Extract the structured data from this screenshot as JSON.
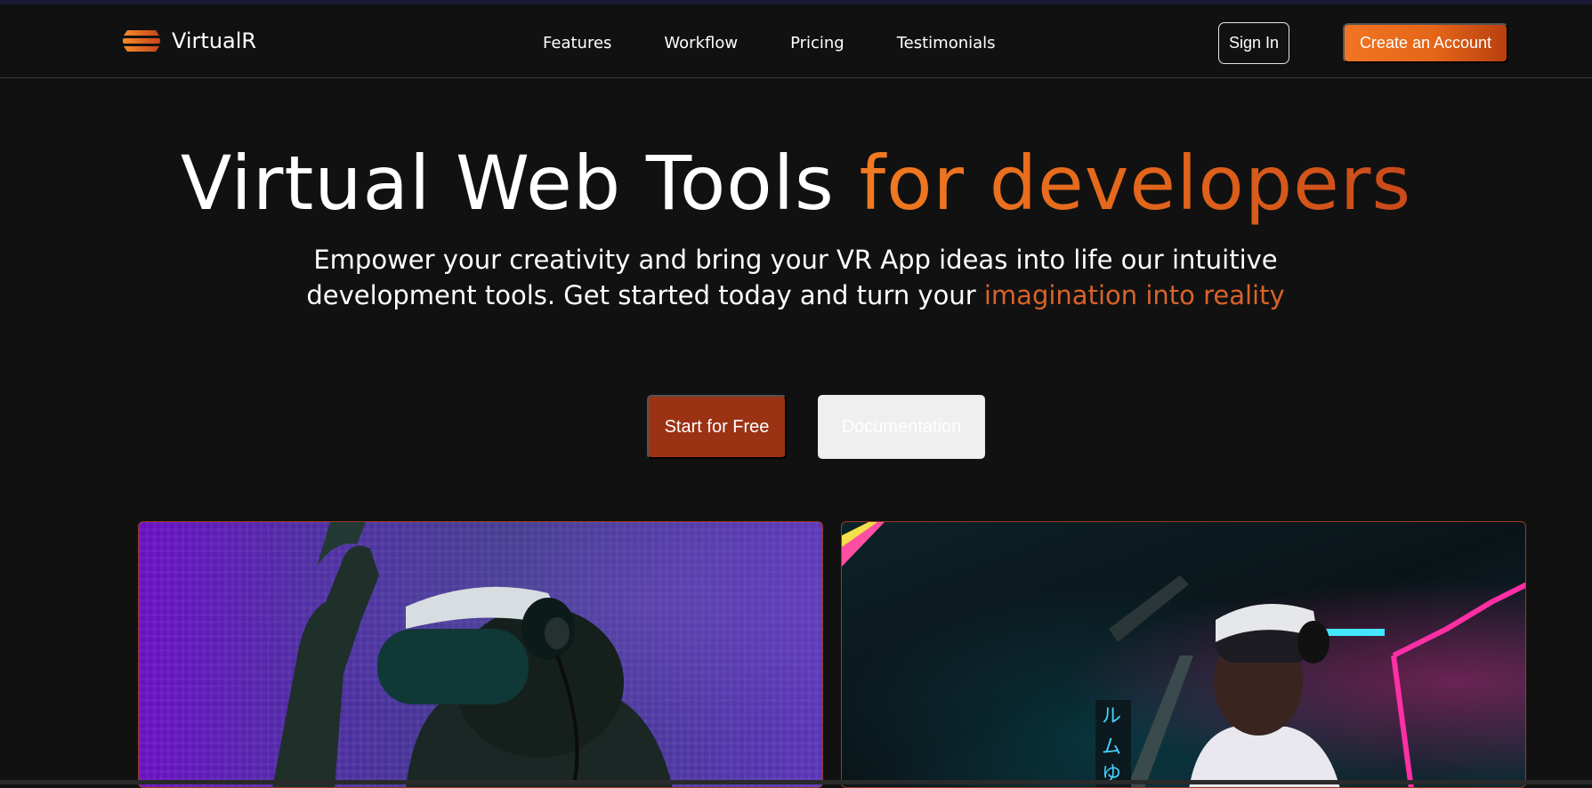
{
  "brand": {
    "name": "VirtualR",
    "logo_icon": "stacked-bars-logo-icon",
    "accent_color": "#f07522"
  },
  "nav": {
    "links": [
      {
        "label": "Features"
      },
      {
        "label": "Workflow"
      },
      {
        "label": "Pricing"
      },
      {
        "label": "Testimonials"
      }
    ],
    "signin_label": "Sign In",
    "create_account_label": "Create an Account"
  },
  "hero": {
    "title_plain": "Virtual Web Tools ",
    "title_accent": "for developers",
    "subtitle_plain": "Empower your creativity and bring your VR App ideas into life our intuitive development tools. Get started today and turn your ",
    "subtitle_accent": "imagination into reality",
    "primary_cta": "Start for Free",
    "secondary_cta": "Documentation"
  },
  "media": {
    "left_image": "vr-headset-user-purple-image",
    "right_image": "vr-headset-user-neon-image"
  }
}
